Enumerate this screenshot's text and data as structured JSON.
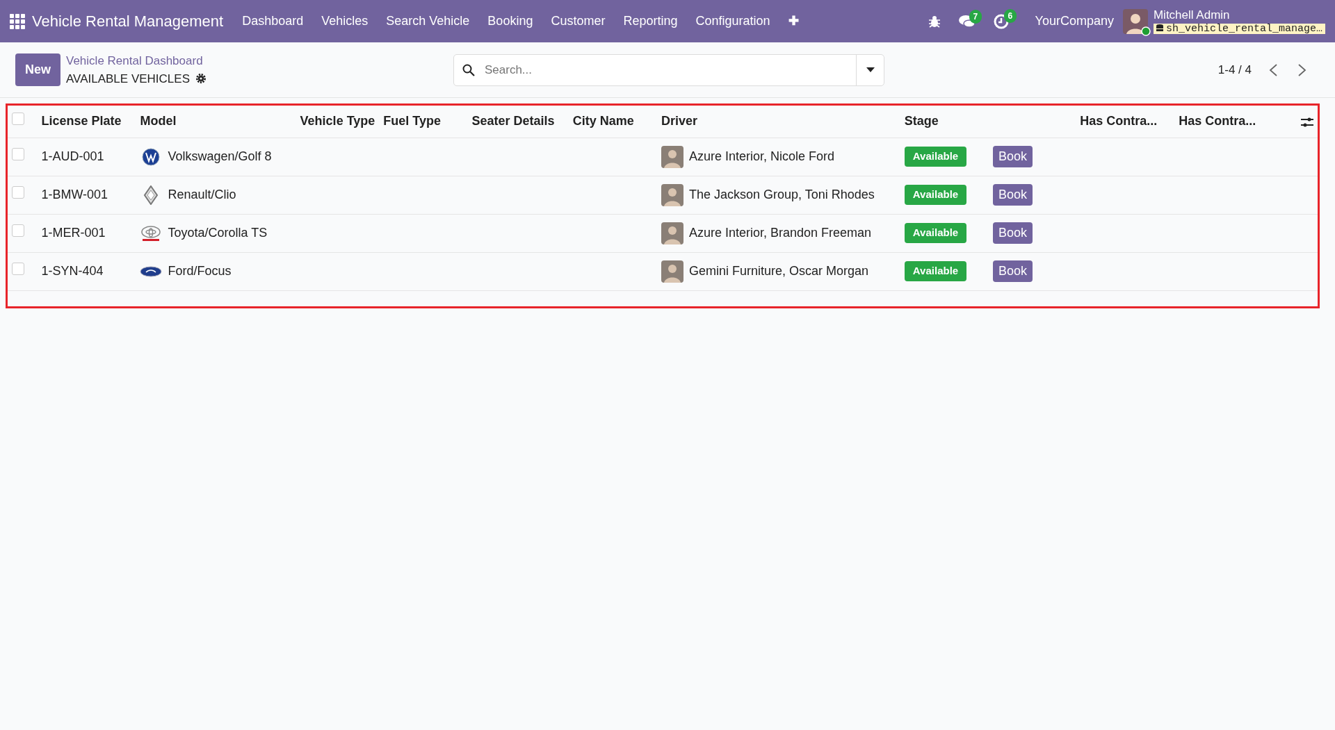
{
  "navbar": {
    "brand": "Vehicle Rental Management",
    "menu": [
      "Dashboard",
      "Vehicles",
      "Search Vehicle",
      "Booking",
      "Customer",
      "Reporting",
      "Configuration"
    ],
    "add_icon": "✚",
    "messages_count": "7",
    "activities_count": "6",
    "company": "YourCompany",
    "user": {
      "name": "Mitchell Admin",
      "database": "sh_vehicle_rental_manage…",
      "online": true
    }
  },
  "control_panel": {
    "new_button": "New",
    "breadcrumb": "Vehicle Rental Dashboard",
    "title": "AVAILABLE VEHICLES",
    "search": {
      "placeholder": "Search..."
    },
    "pager": "1-4 / 4"
  },
  "table": {
    "columns": [
      "License Plate",
      "Model",
      "Vehicle Type",
      "Fuel Type",
      "Seater Details",
      "City Name",
      "Driver",
      "Stage",
      "Has Contra...",
      "Has Contra..."
    ],
    "select_all_checked": false,
    "rows": [
      {
        "checked": false,
        "license_plate": "1-AUD-001",
        "model": "Volkswagen/Golf 8",
        "kind": "round",
        "driver": "Azure Interior, Nicole Ford",
        "stage": "Available",
        "color": "#28a745",
        "action": "Book"
      },
      {
        "checked": false,
        "license_plate": "1-BMW-001",
        "model": "Renault/Clio",
        "kind": "diamond",
        "driver": "The Jackson Group, Toni Rhodes",
        "stage": "Available",
        "color": "#28a745",
        "action": "Book"
      },
      {
        "checked": false,
        "license_plate": "1-MER-001",
        "model": "Toyota/Corolla TS",
        "kind": "rings",
        "driver": "Azure Interior, Brandon Freeman",
        "stage": "Available",
        "color": "#28a745",
        "action": "Book"
      },
      {
        "checked": false,
        "license_plate": "1-SYN-404",
        "model": "Ford/Focus",
        "kind": "oval",
        "driver": "Gemini Furniture, Oscar Morgan",
        "stage": "Available",
        "color": "#28a745",
        "action": "Book"
      }
    ]
  }
}
